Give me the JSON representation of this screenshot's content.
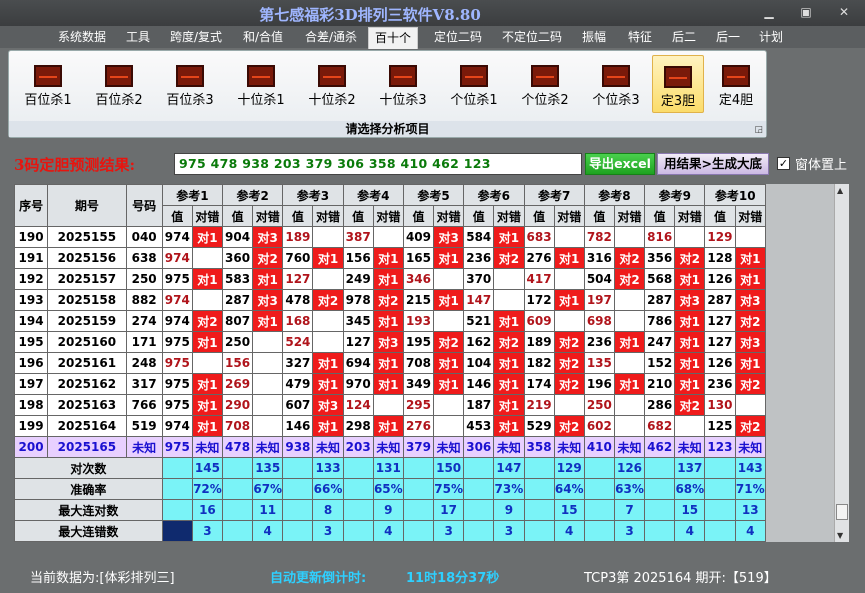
{
  "window": {
    "title": "第七感福彩3D排列三软件V8.80"
  },
  "menu": [
    "系统数据",
    "工具",
    "跨度/复式",
    "和/合值",
    "合差/通杀",
    "百十个",
    "定位二码",
    "不定位二码",
    "振幅",
    "特征",
    "后二",
    "后一",
    "计划"
  ],
  "menu_active": 5,
  "ribbon": {
    "buttons": [
      "百位杀1",
      "百位杀2",
      "百位杀3",
      "十位杀1",
      "十位杀2",
      "十位杀3",
      "个位杀1",
      "个位杀2",
      "个位杀3",
      "定3胆",
      "定4胆"
    ],
    "selected": 9,
    "footer": "请选择分析项目"
  },
  "prediction": {
    "label": "3码定胆预测结果:",
    "value": "975 478 938 203 379 306 358 410 462 123",
    "excel_button": "导出excel",
    "dadi_button": "用结果>生成大底",
    "ontop_label": "窗体置上",
    "ontop_checked": true
  },
  "table": {
    "headers": {
      "seq": "序号",
      "period": "期号",
      "num": "号码",
      "ref": [
        "参考1",
        "参考2",
        "参考3",
        "参考4",
        "参考5",
        "参考6",
        "参考7",
        "参考8",
        "参考9",
        "参考10"
      ],
      "val": "值",
      "mark": "对错"
    },
    "rows": [
      {
        "seq": "190",
        "period": "2025155",
        "num": "040",
        "v": [
          "974",
          "904",
          "189",
          "387",
          "409",
          "584",
          "683",
          "782",
          "816",
          "129"
        ],
        "red": [
          0,
          0,
          1,
          1,
          0,
          0,
          1,
          1,
          1,
          1
        ],
        "m": [
          "对1",
          "对3",
          "",
          "",
          "对3",
          "对1",
          "",
          "",
          "",
          ""
        ]
      },
      {
        "seq": "191",
        "period": "2025156",
        "num": "638",
        "v": [
          "974",
          "360",
          "760",
          "156",
          "165",
          "236",
          "276",
          "316",
          "356",
          "128"
        ],
        "red": [
          1,
          0,
          0,
          0,
          0,
          0,
          0,
          0,
          0,
          0
        ],
        "m": [
          "",
          "对2",
          "对1",
          "对1",
          "对1",
          "对2",
          "对1",
          "对2",
          "对2",
          "对1"
        ]
      },
      {
        "seq": "192",
        "period": "2025157",
        "num": "250",
        "v": [
          "975",
          "583",
          "127",
          "249",
          "346",
          "370",
          "417",
          "504",
          "568",
          "126"
        ],
        "red": [
          0,
          0,
          1,
          0,
          1,
          0,
          1,
          0,
          0,
          0
        ],
        "m": [
          "对1",
          "对1",
          "",
          "对1",
          "",
          "",
          "",
          "对2",
          "对1",
          "对1"
        ]
      },
      {
        "seq": "193",
        "period": "2025158",
        "num": "882",
        "v": [
          "974",
          "287",
          "478",
          "978",
          "215",
          "147",
          "172",
          "197",
          "287",
          "287"
        ],
        "red": [
          1,
          0,
          0,
          0,
          0,
          1,
          0,
          1,
          0,
          0
        ],
        "m": [
          "",
          "对3",
          "对2",
          "对2",
          "对1",
          "",
          "对1",
          "",
          "对3",
          "对3"
        ]
      },
      {
        "seq": "194",
        "period": "2025159",
        "num": "274",
        "v": [
          "974",
          "807",
          "168",
          "345",
          "193",
          "521",
          "609",
          "698",
          "786",
          "127"
        ],
        "red": [
          0,
          0,
          1,
          0,
          1,
          0,
          1,
          1,
          0,
          0
        ],
        "m": [
          "对2",
          "对1",
          "",
          "对1",
          "",
          "对1",
          "",
          "",
          "对1",
          "对2"
        ]
      },
      {
        "seq": "195",
        "period": "2025160",
        "num": "171",
        "v": [
          "975",
          "250",
          "524",
          "127",
          "195",
          "162",
          "189",
          "236",
          "247",
          "127"
        ],
        "red": [
          0,
          0,
          1,
          0,
          0,
          0,
          0,
          0,
          0,
          0
        ],
        "m": [
          "对1",
          "",
          "",
          "对3",
          "对2",
          "对2",
          "对2",
          "对1",
          "对1",
          "对3"
        ]
      },
      {
        "seq": "196",
        "period": "2025161",
        "num": "248",
        "v": [
          "975",
          "156",
          "327",
          "694",
          "708",
          "104",
          "182",
          "135",
          "152",
          "126"
        ],
        "red": [
          1,
          1,
          0,
          0,
          0,
          0,
          0,
          1,
          0,
          0
        ],
        "m": [
          "",
          "",
          "对1",
          "对1",
          "对1",
          "对1",
          "对2",
          "",
          "对1",
          "对1"
        ]
      },
      {
        "seq": "197",
        "period": "2025162",
        "num": "317",
        "v": [
          "975",
          "269",
          "479",
          "970",
          "349",
          "146",
          "174",
          "196",
          "210",
          "236"
        ],
        "red": [
          0,
          1,
          0,
          0,
          0,
          0,
          0,
          0,
          0,
          0
        ],
        "m": [
          "对1",
          "",
          "对1",
          "对1",
          "对1",
          "对1",
          "对2",
          "对1",
          "对1",
          "对2"
        ]
      },
      {
        "seq": "198",
        "period": "2025163",
        "num": "766",
        "v": [
          "975",
          "290",
          "607",
          "124",
          "295",
          "187",
          "219",
          "250",
          "286",
          "130"
        ],
        "red": [
          0,
          1,
          0,
          1,
          1,
          0,
          1,
          1,
          0,
          1
        ],
        "m": [
          "对1",
          "",
          "对3",
          "",
          "",
          "对1",
          "",
          "",
          "对2",
          ""
        ]
      },
      {
        "seq": "199",
        "period": "2025164",
        "num": "519",
        "v": [
          "974",
          "708",
          "146",
          "298",
          "276",
          "453",
          "529",
          "602",
          "682",
          "125"
        ],
        "red": [
          0,
          1,
          0,
          0,
          1,
          0,
          0,
          1,
          1,
          0
        ],
        "m": [
          "对1",
          "",
          "对1",
          "对1",
          "",
          "对1",
          "对2",
          "",
          "",
          "对2"
        ]
      }
    ],
    "pred_row": {
      "seq": "200",
      "period": "2025165",
      "num": "未知",
      "v": [
        "975",
        "478",
        "938",
        "203",
        "379",
        "306",
        "358",
        "410",
        "462",
        "123"
      ],
      "m": "未知"
    },
    "stats": [
      {
        "label": "对次数",
        "vals": [
          "145",
          "135",
          "133",
          "131",
          "150",
          "147",
          "129",
          "126",
          "137",
          "143"
        ]
      },
      {
        "label": "准确率",
        "vals": [
          "72%",
          "67%",
          "66%",
          "65%",
          "75%",
          "73%",
          "64%",
          "63%",
          "68%",
          "71%"
        ]
      },
      {
        "label": "最大连对数",
        "vals": [
          "16",
          "11",
          "8",
          "9",
          "17",
          "9",
          "15",
          "7",
          "15",
          "13"
        ]
      },
      {
        "label": "最大连错数",
        "vals": [
          "3",
          "4",
          "3",
          "4",
          "3",
          "3",
          "4",
          "3",
          "4",
          "4"
        ]
      }
    ]
  },
  "status": {
    "data_label": "当前数据为:[体彩排列三]",
    "countdown_label": "自动更新倒计时:",
    "countdown": "11时18分37秒",
    "tcp": "TCP3第 2025164 期开:【519】"
  },
  "colors": {
    "hit": "#ef1b1b",
    "stat_bg": "#7af3f7",
    "pred_bg": "#e8d0ff",
    "pred_text": "#0a7a0a"
  }
}
